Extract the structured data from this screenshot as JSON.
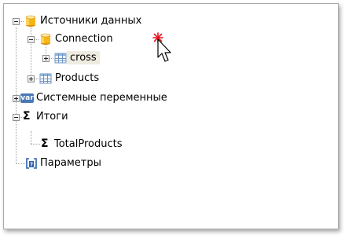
{
  "tree": {
    "items": [
      {
        "label": "Источники данных",
        "icon": "database-icon",
        "expanded": true
      },
      {
        "label": "Connection",
        "icon": "database-icon",
        "expanded": true
      },
      {
        "label": "cross",
        "icon": "table-icon",
        "expanded": false,
        "selected": true
      },
      {
        "label": "Products",
        "icon": "table-icon",
        "expanded": false
      },
      {
        "label": "Системные переменные",
        "icon": "var-icon",
        "expanded": false
      },
      {
        "label": "Итоги",
        "icon": "sigma-icon",
        "expanded": true
      },
      {
        "label": "TotalProducts",
        "icon": "sigma-icon"
      },
      {
        "label": "Параметры",
        "icon": "parameter-icon"
      }
    ]
  },
  "var_icon_text": "var",
  "colors": {
    "selection": "#eeebe0",
    "database_top": "#ffe9a6",
    "database_body": "#f6b618",
    "table_header": "#8fb3d9",
    "var_badge": "#4a78b5",
    "parameter_icon": "#2b61b0",
    "cursor_spark": "#e8141c"
  }
}
